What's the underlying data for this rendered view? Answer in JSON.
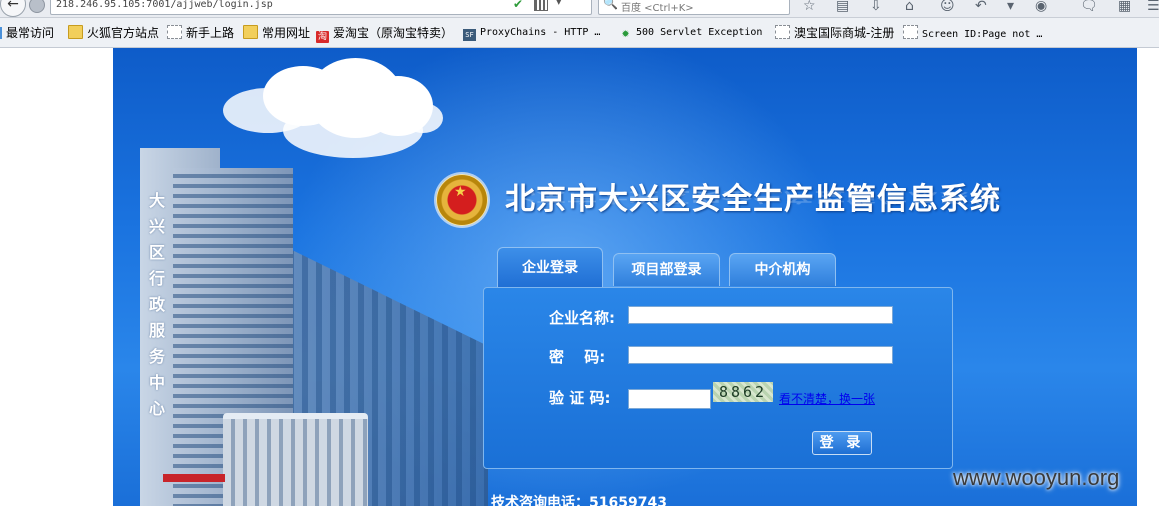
{
  "browser": {
    "url": "218.246.95.105:7001/ajjweb/login.jsp",
    "search_placeholder": "百度 <Ctrl+K>"
  },
  "bookmarks": [
    {
      "label": "最常访问",
      "icon": "folder-icon"
    },
    {
      "label": "火狐官方站点",
      "icon": "folder-icon"
    },
    {
      "label": "新手上路",
      "icon": "page-icon"
    },
    {
      "label": "常用网址",
      "icon": "folder-icon"
    },
    {
      "label": "爱淘宝（原淘宝特卖）",
      "icon": "taobao-icon"
    },
    {
      "label": "ProxyChains - HTTP …",
      "icon": "sf-icon"
    },
    {
      "label": "500 Servlet Exception",
      "icon": "gear-icon"
    },
    {
      "label": "澳宝国际商城-注册",
      "icon": "page-icon"
    },
    {
      "label": "Screen ID:Page not …",
      "icon": "page-icon"
    }
  ],
  "page": {
    "vertical_text": "大兴区行政服务中心",
    "title": "北京市大兴区安全生产监管信息系统",
    "tabs": [
      {
        "label": "企业登录",
        "active": true
      },
      {
        "label": "项目部登录",
        "active": false
      },
      {
        "label": "中介机构",
        "active": false
      }
    ],
    "form": {
      "company_label": "企业名称:",
      "password_label": "密　 码:",
      "captcha_label": "验 证 码:",
      "captcha_code": "8862",
      "refresh_link": "看不清楚，换一张",
      "login_button": "登 录"
    },
    "contact": "技术咨询电话：51659743"
  },
  "watermark": "www.wooyun.org",
  "colors": {
    "page_blue": "#1b74e0",
    "panel_blue": "#1a70d6",
    "emblem_red": "#d41e1e"
  }
}
